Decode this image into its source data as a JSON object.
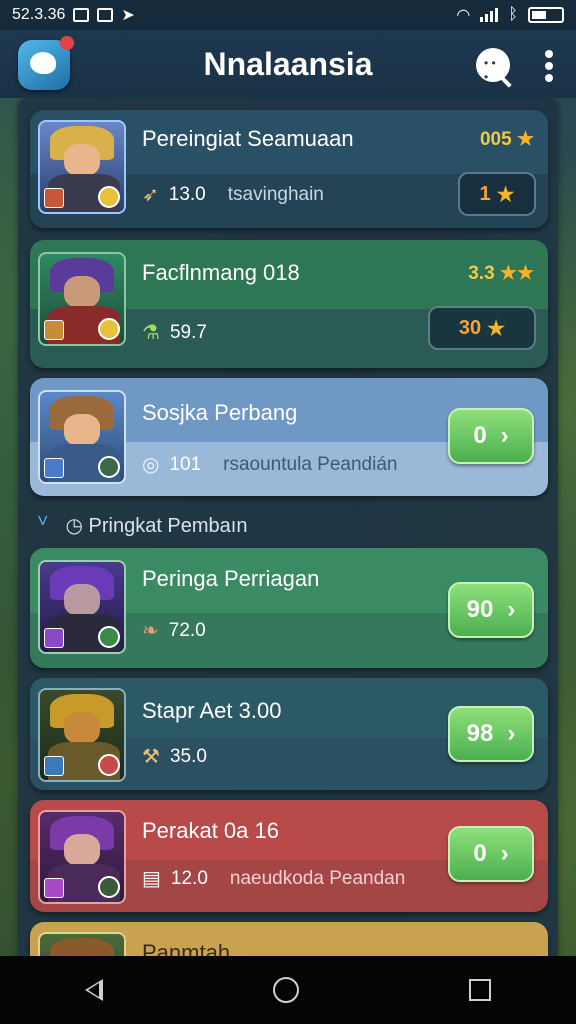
{
  "status": {
    "time": "52.3.36"
  },
  "app": {
    "title": "Nnalaansia"
  },
  "section": {
    "label": "Pringkat Pembaın"
  },
  "cards": [
    {
      "title": "Pereingiat Seamuaan",
      "value": "13.0",
      "sub": "tsavinghain",
      "score": "005",
      "score_stars": "★",
      "badge": "1",
      "badge_star": "★"
    },
    {
      "title": "Facflnmang 018",
      "value": "59.7",
      "score": "3.3",
      "score_stars": "★★",
      "badge": "30",
      "badge_star": "★"
    },
    {
      "title": "Sosjka Perbang",
      "value": "101",
      "sub": "rsaountula Peandián",
      "button": "0"
    },
    {
      "title": "Peringa Perriagan",
      "value": "72.0",
      "button": "90"
    },
    {
      "title": "Stapr Aet 3.00",
      "value": "35.0",
      "button": "98"
    },
    {
      "title": "Perakat 0a 16",
      "value": "12.0",
      "sub": "naeudkoda Peandan",
      "button": "0"
    },
    {
      "title": "Panmtah"
    }
  ],
  "icons": {
    "status": [
      "image-icon",
      "shield-icon",
      "location-icon",
      "wifi-icon",
      "signal-icon",
      "bluetooth-icon",
      "battery-icon"
    ],
    "appbar": [
      "app-logo-icon",
      "search-chat-icon",
      "more-vert-icon"
    ],
    "nav": [
      "back-icon",
      "home-icon",
      "recent-apps-icon"
    ]
  },
  "colors": {
    "button_green": "#4caf50",
    "star": "#f3b32a",
    "panel": "#1e3444"
  }
}
